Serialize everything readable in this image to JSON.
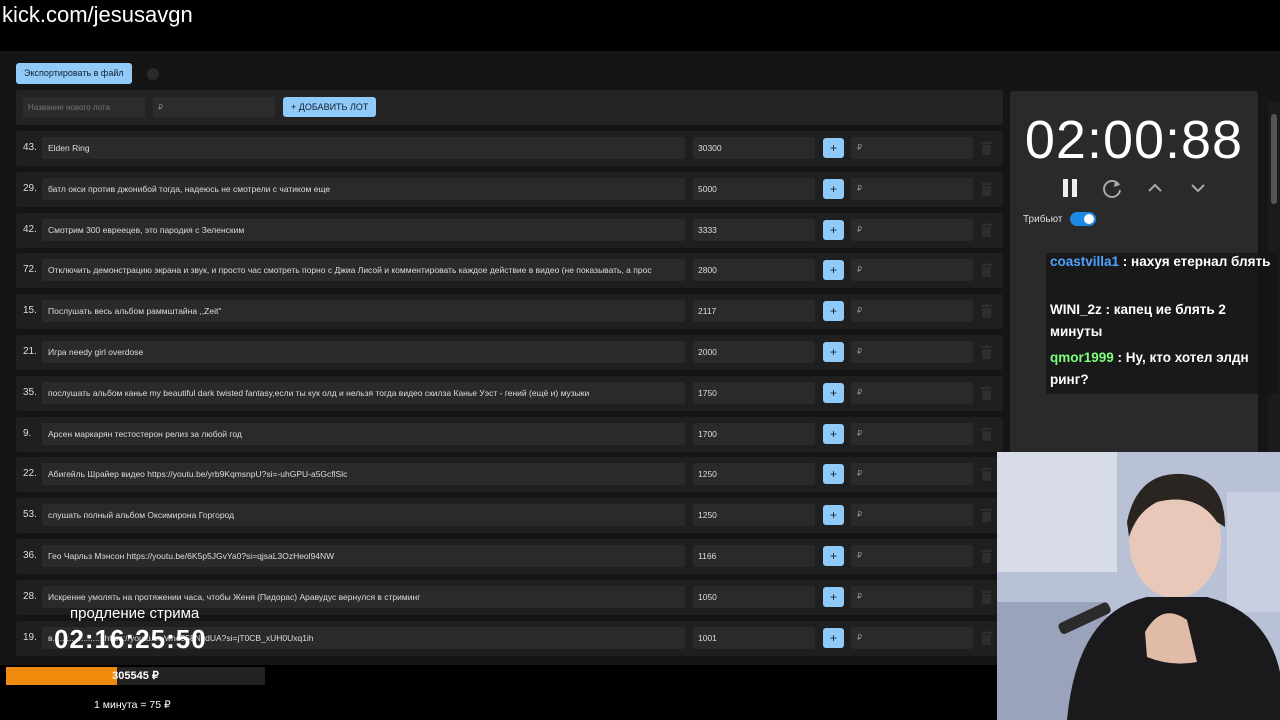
{
  "browser": {
    "url": "kick.com/jesusavgn"
  },
  "toolbar": {
    "export_label": "Экспортировать в файл"
  },
  "add_lot": {
    "name_placeholder": "Название нового лота",
    "amount_placeholder": "₽",
    "add_label": "+ ДОБАВИТЬ ЛОТ"
  },
  "lots": [
    {
      "num": "43.",
      "name": "Elden Ring",
      "sum": "30300"
    },
    {
      "num": "29.",
      "name": "батл окси против джонибой тогда, надеюсь не смотрели с чатиком еще",
      "sum": "5000"
    },
    {
      "num": "42.",
      "name": "Смотрим 300 евреецев, это пародия с Зеленским",
      "sum": "3333"
    },
    {
      "num": "72.",
      "name": "Отключить демонстрацию экрана и звук, и просто час смотреть порно с Джиа Лисой и комментировать каждое действие в видео (не показывать, а прос",
      "sum": "2800"
    },
    {
      "num": "15.",
      "name": "Послушать весь альбом раммштайна ,,Zeit\"",
      "sum": "2117"
    },
    {
      "num": "21.",
      "name": "Игра needy girl overdose",
      "sum": "2000"
    },
    {
      "num": "35.",
      "name": "послушать альбом канье my beautiful dark twisted fantasy,если ты кук олд и нельзя тогда видео скилза Канье Уэст - гений (ещё и) музыки",
      "sum": "1750"
    },
    {
      "num": "9.",
      "name": "Арсен маркарян тестостерон релиз за любой год",
      "sum": "1700"
    },
    {
      "num": "22.",
      "name": "Абигейль Шрайер видео https://youtu.be/yrb9KqmsnpU?si=-uhGPU-a5GcflSlc",
      "sum": "1250"
    },
    {
      "num": "53.",
      "name": "слушать полный альбом Оксимирона Горгород",
      "sum": "1250"
    },
    {
      "num": "36.",
      "name": "Гео Чарльз Мэнсон https://youtu.be/6K5p5JGvYa0?si=qjsaL3OzHeol94NW",
      "sum": "1166"
    },
    {
      "num": "28.",
      "name": "Искренне умолять на протяжении часа, чтобы Женя (Пидорас) Аравудус вернулся в стриминг",
      "sum": "1050"
    },
    {
      "num": "19.",
      "name": "в....................: https://youtu.be/wnd558NcdUA?si=jT0CB_xUH0Uxq1ih",
      "sum": "1001"
    }
  ],
  "lot_row": {
    "plus_label": "+",
    "amount_placeholder": "₽"
  },
  "timer": {
    "value": "02:00:88",
    "tribute_label": "Трибьют",
    "tribute_on": true
  },
  "chat": [
    {
      "user": "coastvilla1",
      "message": " : нахуя етернал блять",
      "color": "#4fa3ff"
    },
    {
      "user": "WINI_2z",
      "message": " : капец ие блять 2 минуты",
      "color": "#ffffff"
    },
    {
      "user": "qmor1999",
      "message": " : Ну, кто хотел элдн ринг?",
      "color": "#7dff7d"
    }
  ],
  "overlay": {
    "label": "продление стрима",
    "time": "02:16:25:50",
    "total": "305545 ₽",
    "progress": 0.43,
    "rate": "1 минута = 75 ₽"
  },
  "colors": {
    "accent": "#90caf9",
    "progress": "#f08a0c",
    "switch": "#1e88e5"
  }
}
